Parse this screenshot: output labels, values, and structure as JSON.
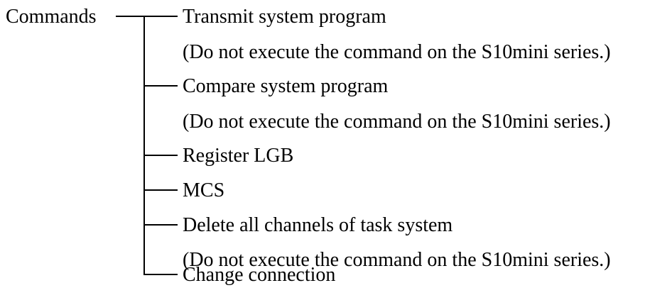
{
  "root": {
    "label": "Commands"
  },
  "items": [
    {
      "label": "Transmit system program",
      "note": "(Do not execute the command on the S10mini series.)"
    },
    {
      "label": "Compare system program",
      "note": "(Do not execute the command on the S10mini series.)"
    },
    {
      "label": "Register LGB"
    },
    {
      "label": "MCS"
    },
    {
      "label": "Delete all channels of task system",
      "note": "(Do not execute the command on the S10mini series.)"
    },
    {
      "label": "Change connection"
    }
  ]
}
